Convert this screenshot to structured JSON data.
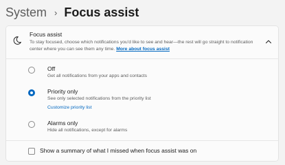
{
  "breadcrumb": {
    "parent": "System",
    "separator": "›",
    "current": "Focus assist"
  },
  "focus_assist": {
    "icon": "moon-icon",
    "title": "Focus assist",
    "description": "To stay focused, choose which notifications you'd like to see and hear—the rest will go straight to notification center where you can see them any time.",
    "link": "More about focus assist",
    "expanded": true,
    "expand_icon": "chevron-up-icon"
  },
  "options": [
    {
      "title": "Off",
      "description": "Get all notifications from your apps and contacts",
      "selected": false
    },
    {
      "title": "Priority only",
      "description": "See only selected notifications from the priority list",
      "link": "Customize priority list",
      "selected": true
    },
    {
      "title": "Alarms only",
      "description": "Hide all notifications, except for alarms",
      "selected": false
    }
  ],
  "summary": {
    "label": "Show a summary of what I missed when focus assist was on",
    "checked": false
  },
  "colors": {
    "accent": "#0067c0",
    "background": "#f3f3f3",
    "card": "#fbfbfb"
  }
}
